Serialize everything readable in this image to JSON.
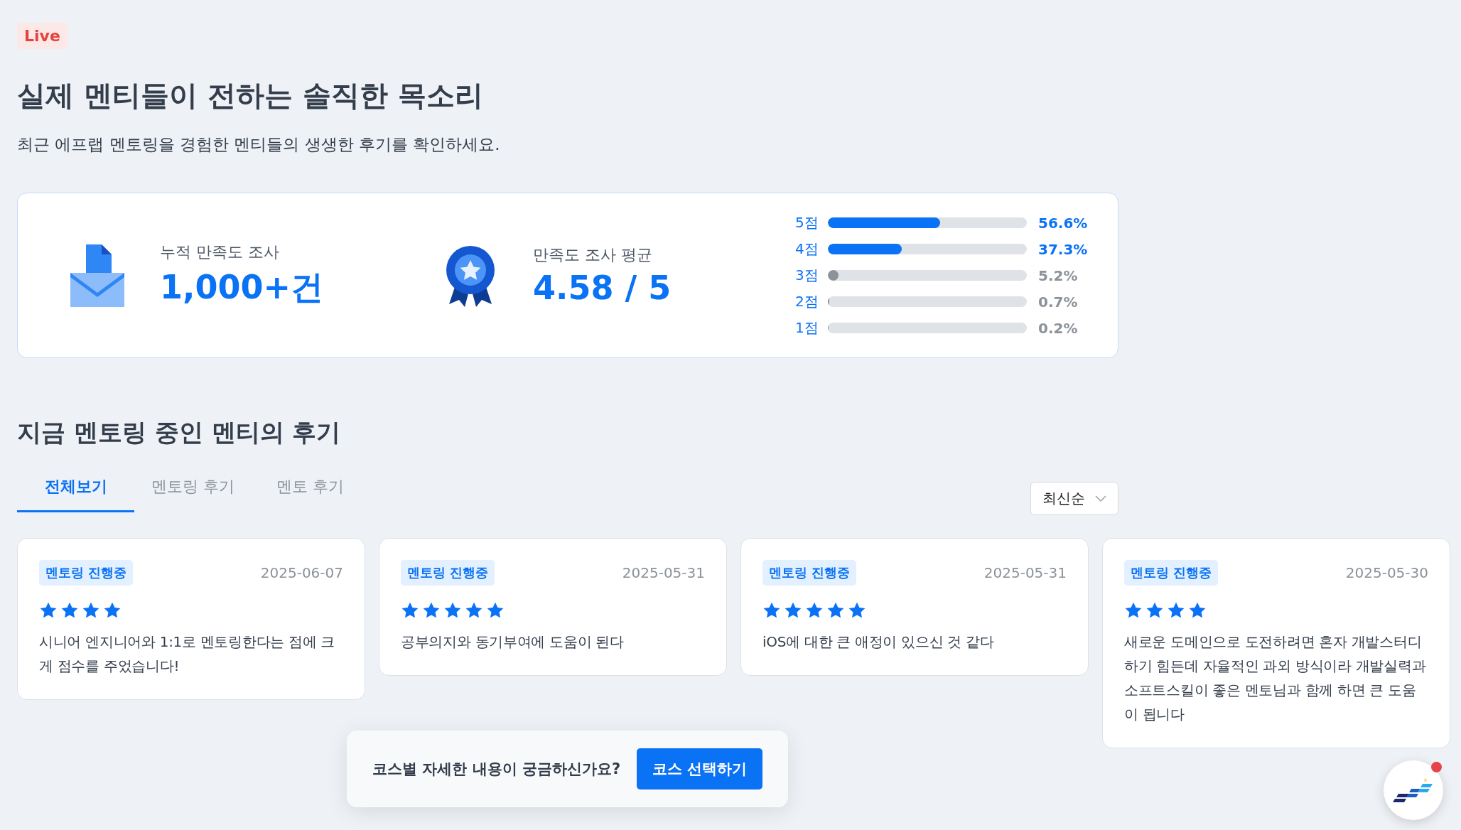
{
  "badge": "Live",
  "title": "실제 멘티들이 전하는 솔직한 목소리",
  "subtitle": "최근 에프랩 멘토링을 경험한 멘티들의 생생한 후기를 확인하세요.",
  "summary": {
    "stats": [
      {
        "kind": "count",
        "label": "누적 만족도 조사",
        "value": "1,000+건"
      },
      {
        "kind": "rating",
        "label": "만족도 조사 평균",
        "value": "4.58 / 5"
      }
    ],
    "distribution": [
      {
        "label": "5점",
        "level": 0.566,
        "reading": "56.6%",
        "highlighted": true
      },
      {
        "label": "4점",
        "level": 0.373,
        "reading": "37.3%",
        "highlighted": true
      },
      {
        "label": "3점",
        "level": 0.052,
        "reading": "5.2%",
        "highlighted": false
      },
      {
        "label": "2점",
        "level": 0.007,
        "reading": "0.7%",
        "highlighted": false
      },
      {
        "label": "1점",
        "level": 0.002,
        "reading": "0.2%",
        "highlighted": false
      }
    ]
  },
  "reviews_section": {
    "title": "지금 멘토링 중인 멘티의 후기",
    "tabs": [
      {
        "label": "전체보기",
        "selected": true
      },
      {
        "label": "멘토링 후기",
        "selected": false
      },
      {
        "label": "멘토 후기",
        "selected": false
      }
    ],
    "sort": {
      "value": "최신순"
    },
    "reviews": [
      {
        "status": "멘토링 진행중",
        "date": "2025-06-07",
        "stars": 4,
        "text": "시니어 엔지니어와 1:1로 멘토링한다는 점에 크게 점수를 주었습니다!"
      },
      {
        "status": "멘토링 진행중",
        "date": "2025-05-31",
        "stars": 5,
        "text": "공부의지와 동기부여에 도움이 된다"
      },
      {
        "status": "멘토링 진행중",
        "date": "2025-05-31",
        "stars": 5,
        "text": "iOS에 대한 큰 애정이 있으신 것 같다"
      },
      {
        "status": "멘토링 진행중",
        "date": "2025-05-30",
        "stars": 4,
        "text": "새로운 도메인으로 도전하려면 혼자 개발스터디 하기 힘든데 자율적인 과외 방식이라 개발실력과소프트스킬이 좋은 멘토님과 함께 하면 큰 도움이 됩니다"
      }
    ]
  },
  "cta": {
    "text": "코스별 자세한 내용이 궁금하신가요?",
    "button": "코스 선택하기"
  },
  "chat_button": {
    "has_notification": true
  }
}
